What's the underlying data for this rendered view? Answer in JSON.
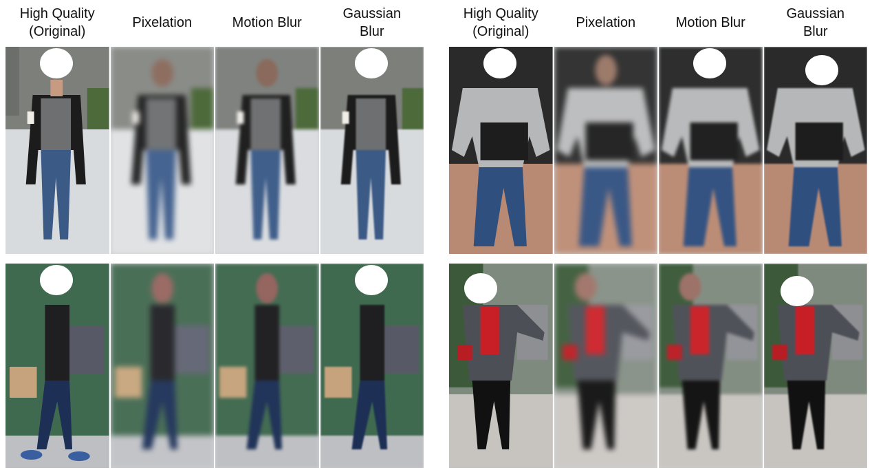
{
  "column_headers": [
    "High Quality\n(Original)",
    "Pixelation",
    "Motion Blur",
    "Gaussian\nBlur"
  ],
  "colors": {
    "street_pavement": "#d9dcde",
    "dark_background": "#2a2a2a",
    "green_wall": "#3f6a4f",
    "denim": "#3b5a86",
    "black_coat": "#1c1c1c",
    "gray_hoodie": "#b6b7b8",
    "red_top": "#c81f27",
    "anonymization_mask": "#ffffff"
  },
  "icons": [
    "face-anonymization-ellipse"
  ]
}
